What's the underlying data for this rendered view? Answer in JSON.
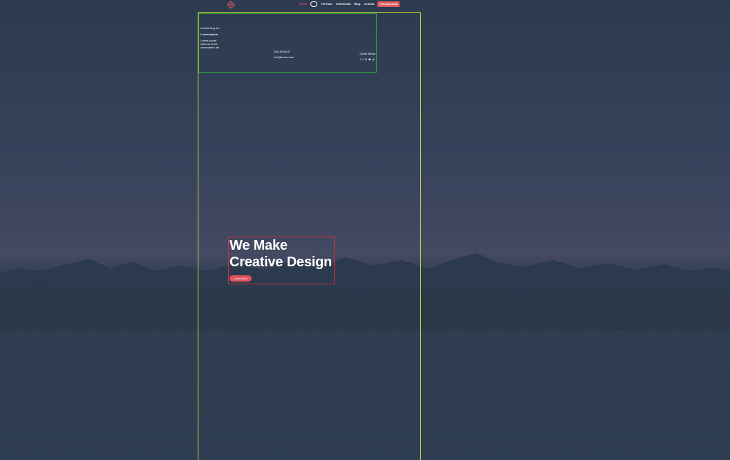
{
  "nav": {
    "logo_icon": "crosshair-logo-icon",
    "items": [
      "Home",
      "",
      "Portfolio",
      "Testimonial",
      "Blog",
      "Contact"
    ],
    "cta_label": "menyusmudk"
  },
  "info": {
    "tagline": "Architecting the",
    "brand": "Lorem Ipsum",
    "description": "Lorem ipsum dolor sit amet, consectetur adi",
    "phone": "0(0)-45-58-87",
    "email": "info@lorem.com",
    "social_title": "Social Media",
    "social_icons": [
      "facebook-icon",
      "twitter-icon",
      "instagram-icon",
      "pinterest-icon",
      "google-plus-icon"
    ]
  },
  "hero": {
    "title_line1": "We Make",
    "title_line2": "Creative Design",
    "button_label": "Learn More"
  },
  "colors": {
    "accent": "#e0545c",
    "background": "#2f3d51",
    "outline_yellow": "#d9e23a",
    "outline_green": "#2e9d3a",
    "outline_red": "#d1303a"
  }
}
